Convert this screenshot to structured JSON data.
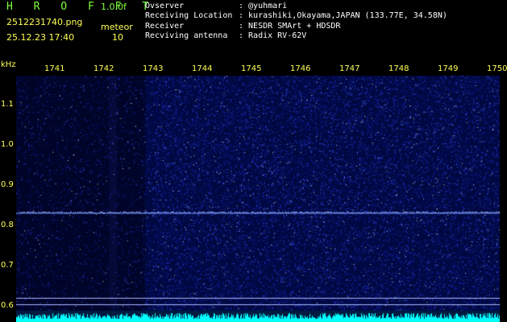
{
  "header": {
    "logo": "H R O F F T",
    "version": "1.0.0f",
    "filename": "2512231740.png",
    "mode": "meteor",
    "datetime": "25.12.23 17:40",
    "count": "10",
    "info": [
      {
        "label": "Ovserver",
        "value": ": @yuhmari"
      },
      {
        "label": "Receiving Location",
        "value": ": kurashiki,Okayama,JAPAN (133.77E, 34.58N)"
      },
      {
        "label": "Receiver",
        "value": ": NESDR SMArt + HDSDR"
      },
      {
        "label": "Recviving antenna",
        "value": ": Radix RV-62V"
      }
    ]
  },
  "axes": {
    "x_unit": "kHz",
    "x_ticks": [
      "1741",
      "1742",
      "1743",
      "1744",
      "1745",
      "1746",
      "1747",
      "1748",
      "1749",
      "1750"
    ],
    "y_ticks": [
      "1.1",
      "1.0",
      "0.9",
      "0.8",
      "0.7",
      "0.6"
    ]
  },
  "colors": {
    "header_green": "#7fff3c",
    "label_yellow": "#ffff55",
    "plot_bg": "#000840",
    "signal_line": "#9fb6ff",
    "noise_cyan": "#00ffff"
  }
}
